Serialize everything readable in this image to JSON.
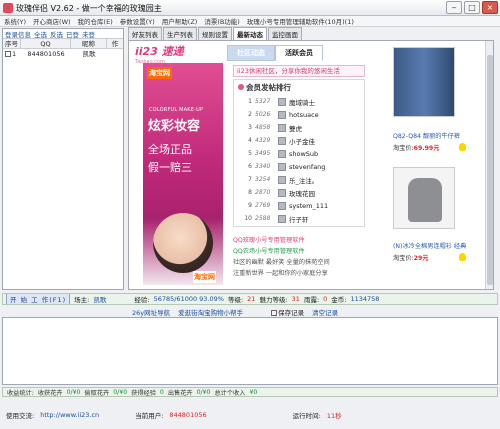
{
  "window": {
    "title": "玫瑰伴侣 V2.62 - 做一个幸福的玫瑰园主"
  },
  "menu": [
    "系统(Y)",
    "开心商店(W)",
    "我的仓库(E)",
    "参数设置(Y)",
    "用户帮助(Z)",
    "消票(B功能)",
    "玫瑰小号专用管理辅助软件(10月)(1)"
  ],
  "left_panel": {
    "header": [
      "登录信息",
      "全选",
      "反选",
      "已登",
      "未登"
    ],
    "columns": [
      "序号",
      "QQ",
      "昵称",
      "作"
    ],
    "rows": [
      {
        "index": "1",
        "qq": "844801056",
        "nick": "凯歌"
      }
    ]
  },
  "browser_tabs": [
    "好友列表",
    "生产列表",
    "规则设置",
    "最新动态",
    "监控画面"
  ],
  "site": {
    "logo": "ii23 速递",
    "logo_sub": "Taobao.com",
    "tabs": [
      "社区动态",
      "活跃会员"
    ],
    "slogan": "ii23休闲社区，分享你我的悠闲生活",
    "ranking_title": "会员发帖排行",
    "ranking": [
      {
        "rank": "1",
        "score": "5327",
        "name": "魔域骑士"
      },
      {
        "rank": "2",
        "score": "5026",
        "name": "hotsuace"
      },
      {
        "rank": "3",
        "score": "4858",
        "name": "雙虎"
      },
      {
        "rank": "4",
        "score": "4329",
        "name": "小子金佳"
      },
      {
        "rank": "5",
        "score": "3495",
        "name": "showSub"
      },
      {
        "rank": "6",
        "score": "3340",
        "name": "stevenfang"
      },
      {
        "rank": "7",
        "score": "3254",
        "name": "乐_注注。"
      },
      {
        "rank": "8",
        "score": "2870",
        "name": "玫瑰花园"
      },
      {
        "rank": "9",
        "score": "2769",
        "name": "system_111"
      },
      {
        "rank": "10",
        "score": "2588",
        "name": "行子轩"
      }
    ],
    "links": [
      {
        "text": "QQ玫瑰小号专用管理软件",
        "color": "pink"
      },
      {
        "text": "QQ农场小号专用管理软件",
        "color": "green"
      },
      {
        "text": "社区的幽默 最好笑 全量的抹苑空间",
        "color": "gray"
      },
      {
        "text": "注重新世界 一起和你的小家庭分享",
        "color": "gray"
      }
    ],
    "ad": {
      "brand": "淘宝网",
      "en": "COLORFUL MAKE-UP",
      "big": "炫彩妆容",
      "line1": "全场正品",
      "line2": "假一赔三",
      "footer": "淘宝网"
    },
    "products": [
      {
        "title": "Q82-Q84 靓丽的牛仔裤",
        "price_label": "淘宝价:",
        "price": "69.99元"
      },
      {
        "title": "(N)冰冷全棉男连帽衫 经典...",
        "price_label": "淘宝价:",
        "price": "29元"
      }
    ]
  },
  "status": {
    "start_button": "开 始 工 作(F1)",
    "farmer_label": "场主:",
    "farmer": "凯歌",
    "exp_label": "经验:",
    "exp": "56785/61000 93.09%",
    "level_label": "等级:",
    "level": "21",
    "charm_label": "魅力等级:",
    "charm": "31",
    "rain_label": "雨露:",
    "rain": "0",
    "gold_label": "金币:",
    "gold": "1134758"
  },
  "logbar": {
    "nav1": "26y网址导航",
    "nav2": "爱逛街淘宝购物小帮手",
    "save": "保存记录",
    "clear": "清空记录"
  },
  "income": {
    "label": "收益统计:",
    "items": [
      "收获花卉",
      "0/¥0",
      "偷取花卉",
      "0/¥0",
      "获得经验",
      "0",
      "出售花卉",
      "0/¥0",
      "总计个收入",
      "¥0"
    ]
  },
  "footer": {
    "use_label": "使用交流:",
    "url": "http://www.ii23.cn",
    "user_label": "当前用户:",
    "user": "844801056",
    "runtime_label": "运行时间:",
    "runtime": "11秒"
  }
}
